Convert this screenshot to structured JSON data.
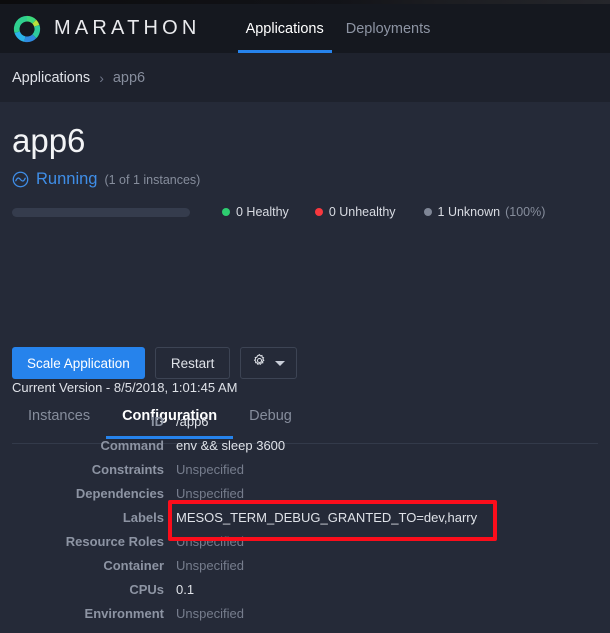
{
  "navbar": {
    "logo_icon": "marathon-donut-logo",
    "brand": "MARATHON",
    "items": [
      {
        "label": "Applications",
        "active": true
      },
      {
        "label": "Deployments",
        "active": false
      }
    ]
  },
  "breadcrumb": {
    "root": "Applications",
    "separator": "›",
    "current": "app6"
  },
  "page": {
    "title": "app6",
    "status_icon": "running-wave-icon",
    "status": "Running",
    "status_detail": "(1 of 1 instances)"
  },
  "health": {
    "bar_percent": 0,
    "items": [
      {
        "label": "0 Healthy",
        "color": "#2ecd70"
      },
      {
        "label": "0 Unhealthy",
        "color": "#f8383e"
      },
      {
        "label": "1 Unknown",
        "color": "#7f8696",
        "percent": "(100%)"
      }
    ]
  },
  "actions": {
    "scale": "Scale Application",
    "restart": "Restart",
    "gear_icon": "gear-icon",
    "caret_icon": "chevron-down-icon"
  },
  "tabs": [
    {
      "label": "Instances",
      "active": false
    },
    {
      "label": "Configuration",
      "active": true
    },
    {
      "label": "Debug",
      "active": false
    }
  ],
  "configuration": {
    "version_label": "Current Version - 8/5/2018, 1:01:45 AM",
    "rows": [
      {
        "key": "ID",
        "value": "/app6",
        "unspecified": false
      },
      {
        "key": "Command",
        "value": "env && sleep 3600",
        "unspecified": false
      },
      {
        "key": "Constraints",
        "value": "Unspecified",
        "unspecified": true
      },
      {
        "key": "Dependencies",
        "value": "Unspecified",
        "unspecified": true
      },
      {
        "key": "Labels",
        "value": "MESOS_TERM_DEBUG_GRANTED_TO=dev,harry",
        "unspecified": false
      },
      {
        "key": "Resource Roles",
        "value": "Unspecified",
        "unspecified": true
      },
      {
        "key": "Container",
        "value": "Unspecified",
        "unspecified": true
      },
      {
        "key": "CPUs",
        "value": "0.1",
        "unspecified": false
      },
      {
        "key": "Environment",
        "value": "Unspecified",
        "unspecified": true
      }
    ]
  },
  "annotation": {
    "color": "#fc0d1b",
    "target": "labels-row-highlight"
  },
  "colors": {
    "accent": "#2683ec",
    "navbar_bg": "#15181f",
    "breadcrumb_bg": "#1e222d",
    "content_bg": "#252a38",
    "healthy": "#2ecd70",
    "unhealthy": "#f8383e",
    "unknown": "#7f8696"
  }
}
